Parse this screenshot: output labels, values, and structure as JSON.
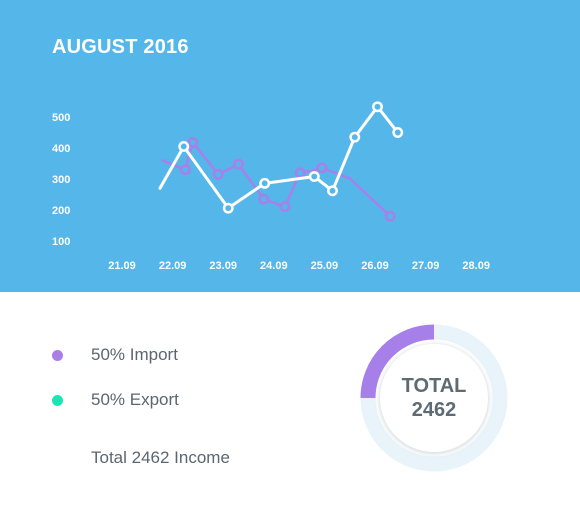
{
  "chart_data": {
    "type": "line",
    "title": "AUGUST 2016",
    "categories": [
      "21.09",
      "22.09",
      "23.09",
      "24.09",
      "25.09",
      "26.09",
      "27.09",
      "28.09"
    ],
    "yticks": [
      500,
      400,
      300,
      200,
      100
    ],
    "ylim": [
      100,
      500
    ],
    "grid": false,
    "series": [
      {
        "color": "#a97fea",
        "x": [
          0.8,
          1.25,
          1.4,
          1.9,
          2.3,
          2.8,
          3.22,
          3.52,
          3.78,
          3.95,
          4.5,
          5.3
        ],
        "values": [
          360,
          330,
          418,
          315,
          348,
          235,
          211,
          320,
          328,
          336,
          302,
          180
        ]
      },
      {
        "color": "#ffffff",
        "x": [
          0.75,
          1.22,
          2.1,
          2.82,
          3.8,
          4.16,
          4.6,
          5.05,
          5.45
        ],
        "values": [
          270,
          405,
          206,
          286,
          308,
          262,
          435,
          533,
          450
        ]
      }
    ]
  },
  "legend": [
    {
      "label": "50% Import",
      "color": "#a87fea"
    },
    {
      "label": "50% Export",
      "color": "#19e6b4"
    }
  ],
  "total_text": "Total 2462 Income",
  "donut": {
    "line1": "TOTAL",
    "line2": "2462",
    "fraction": 0.25,
    "segment_color": "#a77fe9",
    "track_color": "#e8f4fa"
  }
}
